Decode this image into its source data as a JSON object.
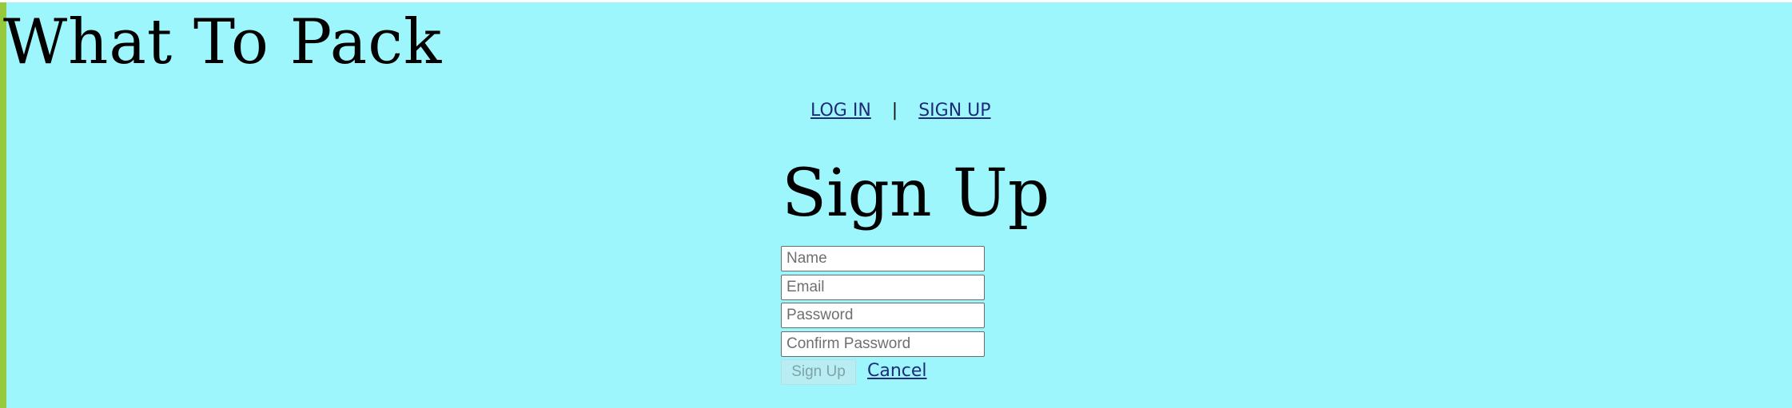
{
  "site": {
    "title": "What To Pack"
  },
  "nav": {
    "login_label": "LOG IN",
    "separator": "|",
    "signup_label": "SIGN UP"
  },
  "signup_form": {
    "title": "Sign Up",
    "fields": {
      "name": {
        "placeholder": "Name",
        "value": ""
      },
      "email": {
        "placeholder": "Email",
        "value": ""
      },
      "password": {
        "placeholder": "Password",
        "value": ""
      },
      "confirm_password": {
        "placeholder": "Confirm Password",
        "value": ""
      }
    },
    "submit_label": "Sign Up",
    "submit_disabled": true,
    "cancel_label": "Cancel"
  },
  "colors": {
    "background": "#9ef6fd",
    "left_accent": "#97c93c",
    "link": "#1f2a78",
    "disabled_button_bg": "#b8eef3"
  }
}
